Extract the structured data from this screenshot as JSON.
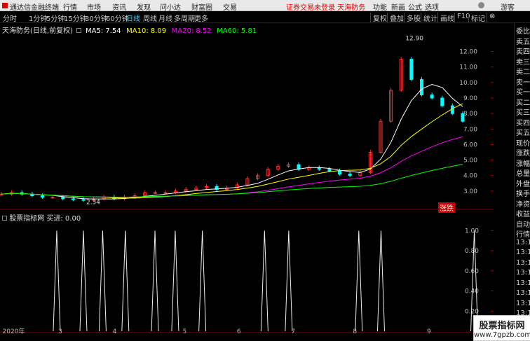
{
  "app_title": "通达信金融终端",
  "menu": [
    "行情",
    "市场",
    "资讯",
    "发现",
    "问小达",
    "财富圈",
    "交易"
  ],
  "login_warning": "证券交易未登录  天海防务",
  "right_menu": [
    "功能",
    "新画",
    "公式",
    "选项",
    "游客"
  ],
  "timeframes": [
    "分时",
    "1分钟",
    "5分钟",
    "15分钟",
    "30分钟",
    "60分钟",
    "日线",
    "周线",
    "月线",
    "多周期",
    "更多"
  ],
  "active_timeframe": "日线",
  "tools": [
    "复权",
    "叠加",
    "多股",
    "统计",
    "画线",
    "F10",
    "标记",
    "⊗"
  ],
  "stock_title": "天海防务(日线,前复权)",
  "ma_labels": [
    {
      "text": "MA5: 7.54",
      "color": "#ffffff"
    },
    {
      "text": "MA10: 8.09",
      "color": "#ffff00"
    },
    {
      "text": "MA20: 8.52",
      "color": "#ff00ff"
    },
    {
      "text": "MA60: 5.81",
      "color": "#00ff00"
    }
  ],
  "price_ticks": [
    "12.00",
    "11.00",
    "10.00",
    "9.00",
    "8.00",
    "7.00",
    "6.00",
    "5.00",
    "4.00",
    "3.00"
  ],
  "peak_label": "12.90",
  "low_label": "2.34",
  "rise_fall_button": "涨跌",
  "indicator_title": "股票指标网 买进: 0.00",
  "indicator_ticks": [
    "1.00",
    "0.80",
    "0.60",
    "0.40",
    "0.20"
  ],
  "x_labels": [
    "2020年",
    "3",
    "4",
    "5",
    "6",
    "7",
    "8",
    "9"
  ],
  "side_panel": [
    "委比",
    "卖五",
    "卖四",
    "卖三",
    "卖二",
    "卖一",
    "买一",
    "买二",
    "买三",
    "买四",
    "买五",
    "现价",
    "涨跌",
    "涨幅",
    "总量",
    "外盘",
    "换手",
    "净资",
    "收益",
    "自动",
    "行情",
    "13:1",
    "13:1",
    "13:1",
    "13:1",
    "13:1",
    "13:1",
    "13:1",
    "13:1",
    "13:1"
  ],
  "chart_data": {
    "type": "candlestick",
    "title": "天海防务(日线,前复权)",
    "x_labels": [
      "2020年",
      "3",
      "4",
      "5",
      "6",
      "7",
      "8",
      "9"
    ],
    "ylim": [
      2.0,
      13.2
    ],
    "y_ticks": [
      3,
      4,
      5,
      6,
      7,
      8,
      9,
      10,
      11,
      12
    ],
    "annotations": [
      {
        "label": "12.90"
      },
      {
        "label": "2.34"
      }
    ],
    "ma_latest": {
      "MA5": 7.54,
      "MA10": 8.09,
      "MA20": 8.52,
      "MA60": 5.81
    },
    "price_series": [
      {
        "name": "close",
        "values": [
          2.8,
          2.9,
          2.8,
          2.7,
          2.6,
          2.6,
          2.5,
          2.45,
          2.4,
          2.5,
          2.6,
          2.5,
          2.6,
          2.7,
          2.9,
          2.9,
          2.9,
          3.0,
          3.1,
          3.2,
          3.3,
          3.1,
          3.2,
          3.4,
          3.8,
          4.0,
          4.4,
          4.6,
          4.7,
          4.4,
          4.5,
          4.4,
          4.3,
          4.1,
          4.0,
          4.2,
          5.5,
          7.5,
          9.5,
          11.5,
          10.2,
          9.2,
          9.0,
          8.5,
          8.0,
          7.5
        ]
      }
    ],
    "indicator": {
      "name": "买进",
      "ylim": [
        0,
        1.1
      ],
      "spike_x_fraction": [
        0.115,
        0.169,
        0.208,
        0.254,
        0.314,
        0.355,
        0.41,
        0.536,
        0.585,
        0.727,
        0.772,
        0.961
      ]
    }
  },
  "watermark": {
    "line1": "股票指标网",
    "line2": "www.7gpzb.com"
  }
}
